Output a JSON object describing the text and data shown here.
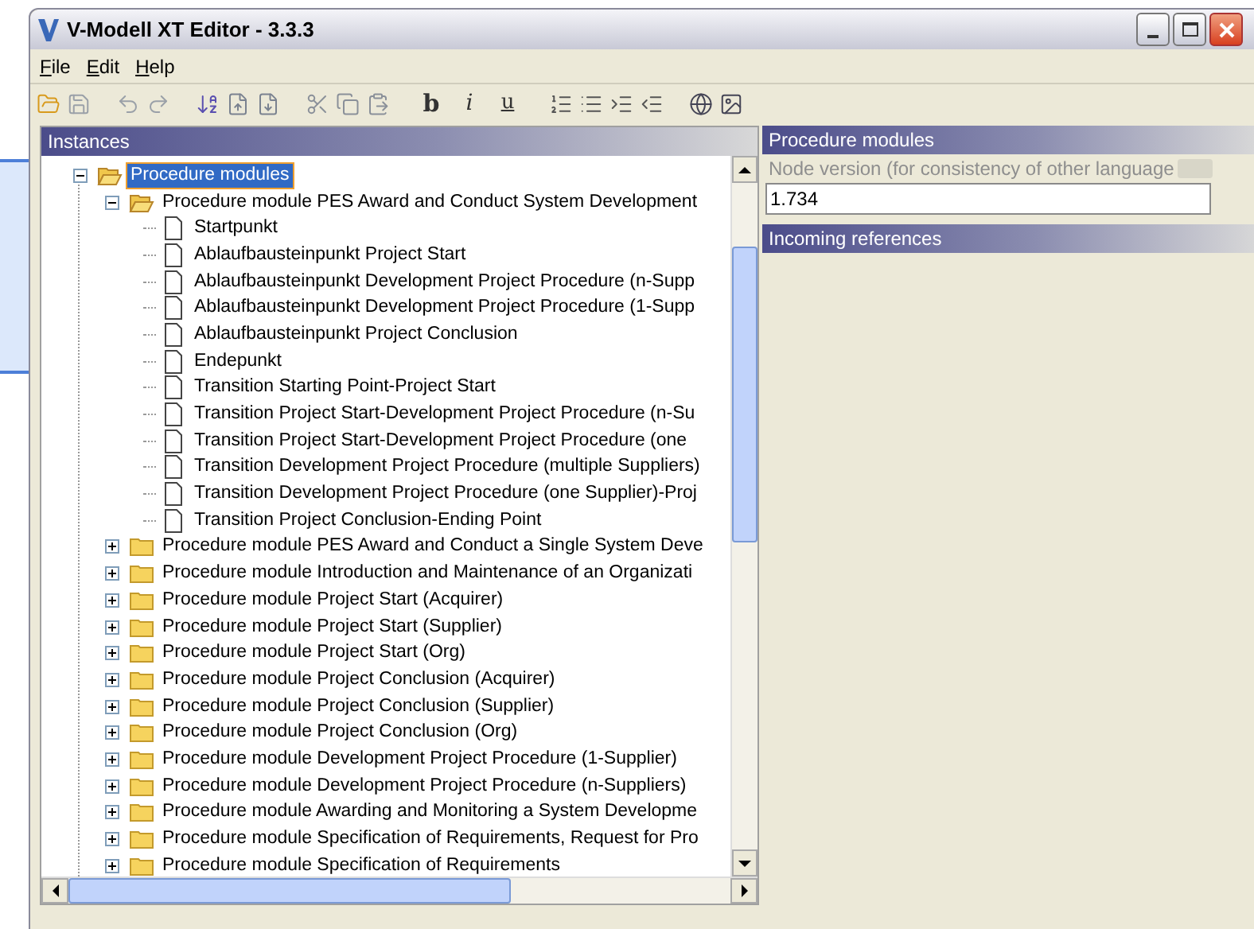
{
  "window": {
    "title": "V-Modell XT Editor - 3.3.3"
  },
  "menu": [
    "File",
    "Edit",
    "Help"
  ],
  "toolbar": [
    {
      "label": "b",
      "kind": "bold"
    },
    {
      "label": "i",
      "kind": "italic"
    },
    {
      "label": "u",
      "kind": "underline"
    }
  ],
  "instances": {
    "title": "Instances",
    "tree": [
      {
        "label": "Procedure modules",
        "kind": "folder",
        "expanded": true,
        "selected": true,
        "children": [
          {
            "label": "Procedure module PES Award and Conduct System Development",
            "kind": "folder",
            "expanded": true,
            "selected": false,
            "children": [
              {
                "label": "Startpunkt",
                "kind": "leaf",
                "selected": false
              },
              {
                "label": "Ablaufbausteinpunkt Project Start",
                "kind": "leaf",
                "selected": false
              },
              {
                "label": "Ablaufbausteinpunkt Development Project Procedure (n-Supp",
                "kind": "leaf",
                "selected": false
              },
              {
                "label": "Ablaufbausteinpunkt Development Project Procedure (1-Supp",
                "kind": "leaf",
                "selected": false
              },
              {
                "label": "Ablaufbausteinpunkt Project Conclusion",
                "kind": "leaf",
                "selected": false
              },
              {
                "label": "Endepunkt",
                "kind": "leaf",
                "selected": false
              },
              {
                "label": "Transition Starting Point-Project Start",
                "kind": "leaf",
                "selected": false
              },
              {
                "label": "Transition Project Start-Development Project Procedure (n-Su",
                "kind": "leaf",
                "selected": false
              },
              {
                "label": "Transition Project Start-Development Project Procedure (one",
                "kind": "leaf",
                "selected": false
              },
              {
                "label": "Transition Development Project Procedure (multiple Suppliers)",
                "kind": "leaf",
                "selected": false
              },
              {
                "label": "Transition Development Project Procedure (one Supplier)-Proj",
                "kind": "leaf",
                "selected": false
              },
              {
                "label": "Transition Project Conclusion-Ending Point",
                "kind": "leaf",
                "selected": false
              }
            ]
          },
          {
            "label": "Procedure module PES Award and Conduct a Single System Deve",
            "kind": "folder",
            "expanded": false,
            "selected": false
          },
          {
            "label": "Procedure module Introduction and Maintenance of an Organizati",
            "kind": "folder",
            "expanded": false,
            "selected": false
          },
          {
            "label": "Procedure module Project Start (Acquirer)",
            "kind": "folder",
            "expanded": false,
            "selected": false
          },
          {
            "label": "Procedure module Project Start (Supplier)",
            "kind": "folder",
            "expanded": false,
            "selected": false
          },
          {
            "label": "Procedure module Project Start (Org)",
            "kind": "folder",
            "expanded": false,
            "selected": false
          },
          {
            "label": "Procedure module Project Conclusion (Acquirer)",
            "kind": "folder",
            "expanded": false,
            "selected": false
          },
          {
            "label": "Procedure module Project Conclusion (Supplier)",
            "kind": "folder",
            "expanded": false,
            "selected": false
          },
          {
            "label": "Procedure module Project Conclusion (Org)",
            "kind": "folder",
            "expanded": false,
            "selected": false
          },
          {
            "label": "Procedure module Development Project Procedure (1-Supplier)",
            "kind": "folder",
            "expanded": false,
            "selected": false
          },
          {
            "label": "Procedure module Development Project Procedure (n-Suppliers)",
            "kind": "folder",
            "expanded": false,
            "selected": false
          },
          {
            "label": "Procedure module Awarding and Monitoring a System Developme",
            "kind": "folder",
            "expanded": false,
            "selected": false
          },
          {
            "label": "Procedure module Specification of Requirements, Request for Pro",
            "kind": "folder",
            "expanded": false,
            "selected": false
          },
          {
            "label": "Procedure module Specification of Requirements",
            "kind": "folder",
            "expanded": false,
            "selected": false
          }
        ]
      }
    ]
  },
  "details": {
    "title": "Procedure modules",
    "field_label": "Node version (for consistency of other language",
    "field_value": "1.734",
    "references_title": "Incoming references"
  }
}
